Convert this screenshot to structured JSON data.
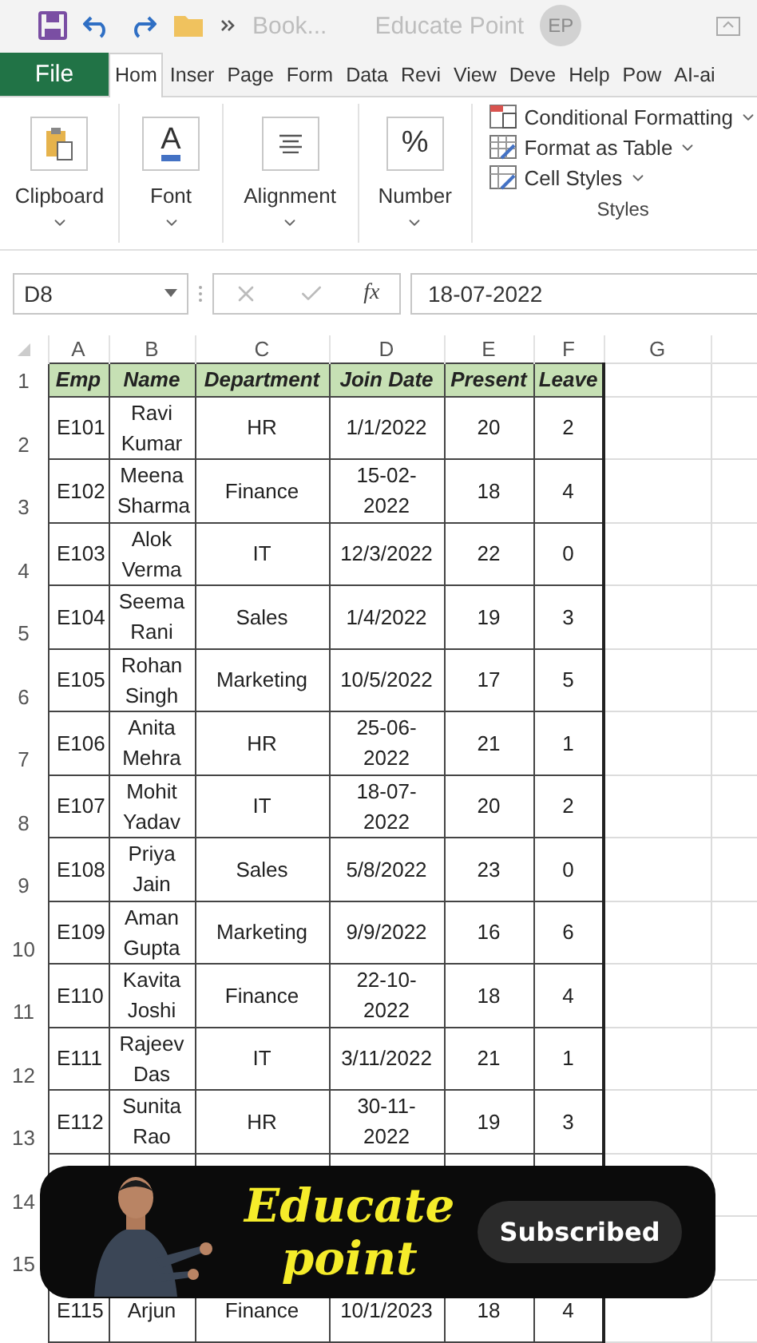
{
  "title_bar": {
    "file_name": "Book...",
    "account_name": "Educate Point",
    "account_initials": "EP"
  },
  "tabs": [
    {
      "label": "File",
      "kind": "file",
      "selected": false
    },
    {
      "label": "Hom",
      "kind": "tab",
      "selected": true
    },
    {
      "label": "Inser",
      "kind": "tab",
      "selected": false
    },
    {
      "label": "Page",
      "kind": "tab",
      "selected": false
    },
    {
      "label": "Form",
      "kind": "tab",
      "selected": false
    },
    {
      "label": "Data",
      "kind": "tab",
      "selected": false
    },
    {
      "label": "Revi",
      "kind": "tab",
      "selected": false
    },
    {
      "label": "View",
      "kind": "tab",
      "selected": false
    },
    {
      "label": "Deve",
      "kind": "tab",
      "selected": false
    },
    {
      "label": "Help",
      "kind": "tab",
      "selected": false
    },
    {
      "label": "Pow",
      "kind": "tab",
      "selected": false
    },
    {
      "label": "AI-ai",
      "kind": "tab",
      "selected": false
    }
  ],
  "ribbon": {
    "groups": [
      {
        "label": "Clipboard",
        "kind": "clipboard"
      },
      {
        "label": "Font",
        "kind": "glyph",
        "glyph": "A"
      },
      {
        "label": "Alignment",
        "kind": "alignment"
      },
      {
        "label": "Number",
        "kind": "glyph",
        "glyph": "%"
      }
    ],
    "styles": {
      "items": [
        {
          "label": "Conditional Formatting",
          "kind": "conditional"
        },
        {
          "label": "Format as Table",
          "kind": "table"
        },
        {
          "label": "Cell Styles",
          "kind": "cell"
        }
      ],
      "label": "Styles"
    }
  },
  "formula_bar": {
    "name_box": "D8",
    "function_button": "fx",
    "value": "18-07-2022"
  },
  "sheet": {
    "columns": [
      "A",
      "B",
      "C",
      "D",
      "E",
      "F",
      "G"
    ],
    "header_row": {
      "number": "1",
      "cells": [
        "Emp",
        "Name",
        "Department",
        "Join Date",
        "Present",
        "Leave"
      ]
    },
    "rows": [
      {
        "number": "2",
        "cells": [
          "E101",
          "Ravi Kumar",
          "HR",
          "1/1/2022",
          "20",
          "2"
        ]
      },
      {
        "number": "3",
        "cells": [
          "E102",
          "Meena Sharma",
          "Finance",
          "15-02-2022",
          "18",
          "4"
        ]
      },
      {
        "number": "4",
        "cells": [
          "E103",
          "Alok Verma",
          "IT",
          "12/3/2022",
          "22",
          "0"
        ]
      },
      {
        "number": "5",
        "cells": [
          "E104",
          "Seema Rani",
          "Sales",
          "1/4/2022",
          "19",
          "3"
        ]
      },
      {
        "number": "6",
        "cells": [
          "E105",
          "Rohan Singh",
          "Marketing",
          "10/5/2022",
          "17",
          "5"
        ]
      },
      {
        "number": "7",
        "cells": [
          "E106",
          "Anita Mehra",
          "HR",
          "25-06-2022",
          "21",
          "1"
        ]
      },
      {
        "number": "8",
        "cells": [
          "E107",
          "Mohit Yadav",
          "IT",
          "18-07-2022",
          "20",
          "2"
        ]
      },
      {
        "number": "9",
        "cells": [
          "E108",
          "Priya Jain",
          "Sales",
          "5/8/2022",
          "23",
          "0"
        ]
      },
      {
        "number": "10",
        "cells": [
          "E109",
          "Aman Gupta",
          "Marketing",
          "9/9/2022",
          "16",
          "6"
        ]
      },
      {
        "number": "11",
        "cells": [
          "E110",
          "Kavita Joshi",
          "Finance",
          "22-10-2022",
          "18",
          "4"
        ]
      },
      {
        "number": "12",
        "cells": [
          "E111",
          "Rajeev Das",
          "IT",
          "3/11/2022",
          "21",
          "1"
        ]
      },
      {
        "number": "13",
        "cells": [
          "E112",
          "Sunita Rao",
          "HR",
          "30-11-2022",
          "19",
          "3"
        ]
      },
      {
        "number": "14",
        "cells": []
      },
      {
        "number": "15",
        "cells": []
      },
      {
        "cells": [
          "E115",
          "Arjun",
          "Finance",
          "10/1/2023",
          "18",
          "4"
        ]
      }
    ]
  },
  "overlay": {
    "channel_name": "Educate point",
    "subscribe_button": "Subscribed"
  }
}
